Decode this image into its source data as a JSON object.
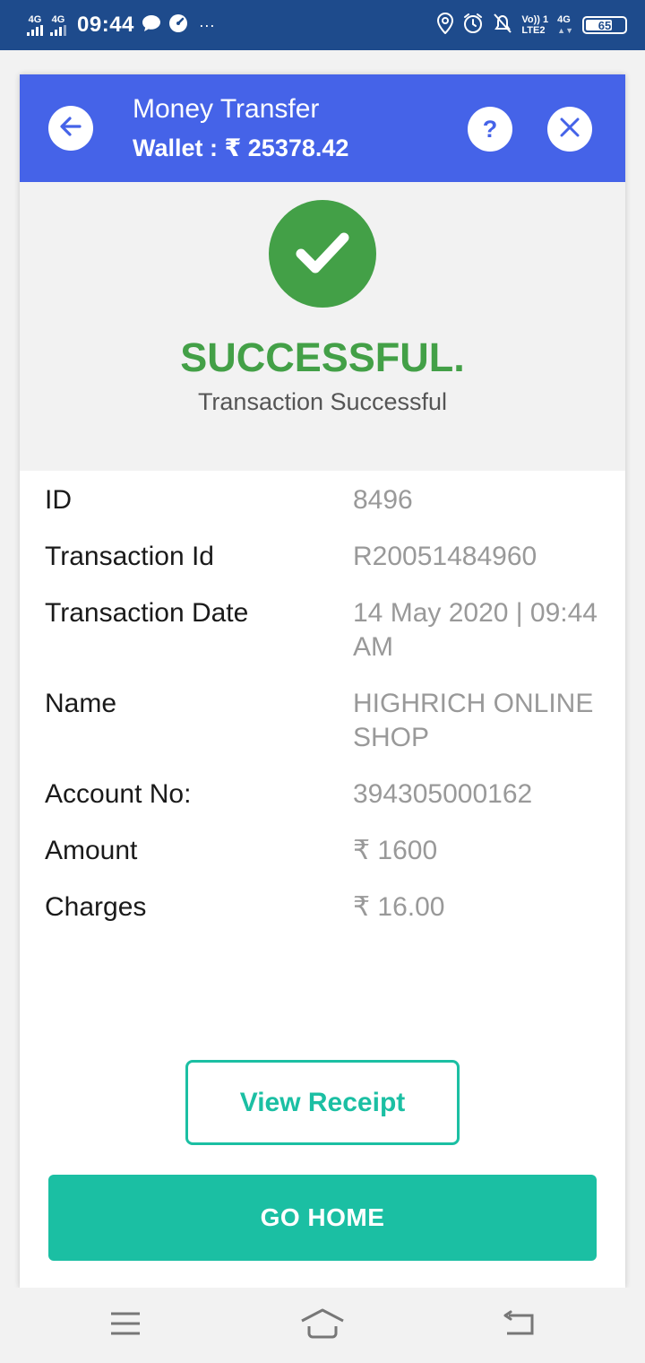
{
  "status_bar": {
    "net1": "4G",
    "net2": "4G",
    "time": "09:44",
    "more": "···",
    "volte": "Vo))",
    "lte": "LTE2",
    "lte_num": "1",
    "net3": "4G",
    "battery": "65"
  },
  "header": {
    "title": "Money Transfer",
    "wallet": "Wallet : ₹ 25378.42",
    "help_label": "?"
  },
  "status": {
    "title": "SUCCESSFUL.",
    "subtitle": "Transaction Successful",
    "color": "#43a047"
  },
  "details": [
    {
      "label": "ID",
      "value": "8496"
    },
    {
      "label": "Transaction Id",
      "value": "R20051484960"
    },
    {
      "label": "Transaction Date",
      "value": "14 May 2020 | 09:44 AM"
    },
    {
      "label": "Name",
      "value": "HIGHRICH ONLINE SHOP"
    },
    {
      "label": "Account No:",
      "value": "394305000162"
    },
    {
      "label": "Amount",
      "value": "₹ 1600"
    },
    {
      "label": "Charges",
      "value": "₹ 16.00"
    }
  ],
  "actions": {
    "view_receipt": "View Receipt",
    "go_home": "GO HOME"
  },
  "colors": {
    "header": "#4563e8",
    "accent": "#1bbfa3",
    "status_bar": "#1e4b8c"
  },
  "icons": {
    "back": "arrow-left-icon",
    "help": "question-icon",
    "close": "close-icon",
    "success": "check-icon",
    "nav_menu": "menu-icon",
    "nav_home": "home-icon",
    "nav_back": "back-icon"
  }
}
